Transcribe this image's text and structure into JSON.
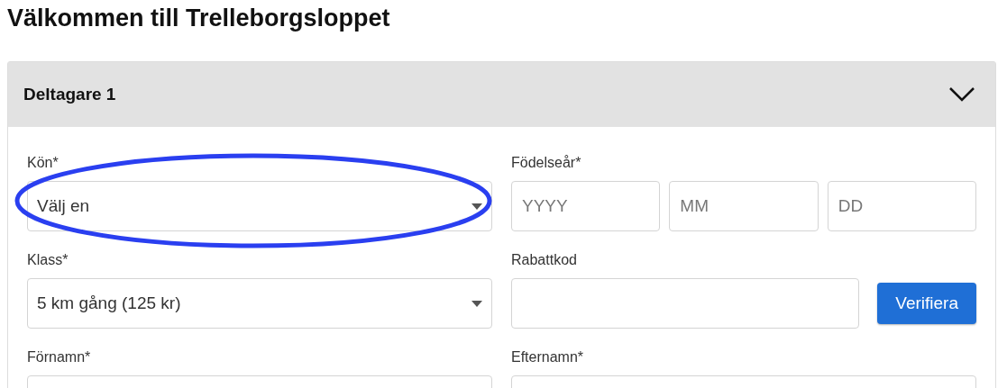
{
  "page_title": "Välkommen till Trelleborgsloppet",
  "panel": {
    "title": "Deltagare 1",
    "expanded": true
  },
  "rows": [
    {
      "left": {
        "kind": "select",
        "label": "Kön*",
        "value": "Välj en",
        "annotated": true
      },
      "right": {
        "kind": "date",
        "label": "Födelseår*",
        "placeholders": [
          "YYYY",
          "MM",
          "DD"
        ]
      }
    },
    {
      "left": {
        "kind": "select",
        "label": "Klass*",
        "value": "5 km gång (125 kr)"
      },
      "right": {
        "kind": "code",
        "label": "Rabattkod",
        "button": "Verifiera"
      }
    },
    {
      "left": {
        "kind": "text",
        "label": "Förnamn*"
      },
      "right": {
        "kind": "text",
        "label": "Efternamn*"
      }
    }
  ]
}
